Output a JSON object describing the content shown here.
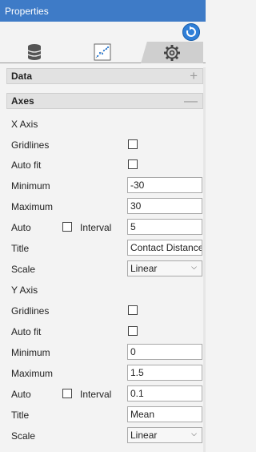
{
  "window": {
    "title": "Properties"
  },
  "icons": {
    "refresh": "refresh-icon",
    "tab1": "database-icon",
    "tab2": "scatter-plot-icon",
    "tab3": "gear-icon"
  },
  "sections": {
    "data": {
      "label": "Data",
      "control": "+"
    },
    "axes": {
      "label": "Axes",
      "control": "—"
    }
  },
  "x_axis": {
    "header": "X Axis",
    "gridlines_label": "Gridlines",
    "autofit_label": "Auto fit",
    "minimum_label": "Minimum",
    "minimum_value": "-30",
    "maximum_label": "Maximum",
    "maximum_value": "30",
    "auto_label": "Auto",
    "interval_label": "Interval",
    "interval_value": "5",
    "title_label": "Title",
    "title_value": "Contact Distance",
    "scale_label": "Scale",
    "scale_value": "Linear"
  },
  "y_axis": {
    "header": "Y Axis",
    "gridlines_label": "Gridlines",
    "autofit_label": "Auto fit",
    "minimum_label": "Minimum",
    "minimum_value": "0",
    "maximum_label": "Maximum",
    "maximum_value": "1.5",
    "auto_label": "Auto",
    "interval_label": "Interval",
    "interval_value": "0.1",
    "title_label": "Title",
    "title_value": "Mean",
    "scale_label": "Scale",
    "scale_value": "Linear"
  },
  "colors": {
    "titlebar": "#3e7bc7",
    "accent": "#2f7fd8"
  }
}
